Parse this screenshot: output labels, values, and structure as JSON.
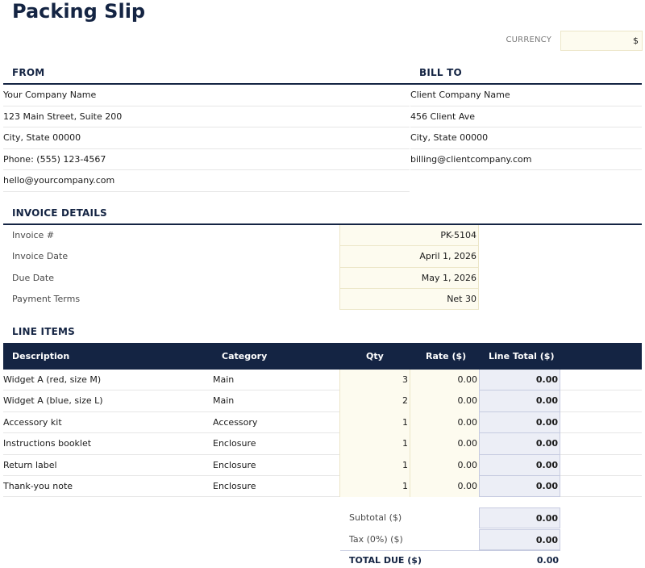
{
  "title": "Packing Slip",
  "currency": {
    "label": "CURRENCY",
    "value": "$"
  },
  "from": {
    "heading": "FROM",
    "lines": [
      "Your Company Name",
      "123 Main Street, Suite 200",
      "City, State 00000",
      "Phone: (555) 123-4567",
      "hello@yourcompany.com"
    ]
  },
  "bill_to": {
    "heading": "BILL TO",
    "lines": [
      "Client Company Name",
      "456 Client Ave",
      "City, State 00000",
      "billing@clientcompany.com"
    ]
  },
  "invoice_details": {
    "heading": "INVOICE DETAILS",
    "rows": [
      {
        "label": "Invoice #",
        "value": "PK-5104"
      },
      {
        "label": "Invoice Date",
        "value": "April 1, 2026"
      },
      {
        "label": "Due Date",
        "value": "May 1, 2026"
      },
      {
        "label": "Payment Terms",
        "value": "Net 30"
      }
    ]
  },
  "line_items": {
    "heading": "LINE ITEMS",
    "columns": {
      "description": "Description",
      "category": "Category",
      "qty": "Qty",
      "rate": "Rate ($)",
      "line_total": "Line Total ($)"
    },
    "rows": [
      {
        "description": "Widget A (red, size M)",
        "category": "Main",
        "qty": "3",
        "rate": "0.00",
        "line_total": "0.00"
      },
      {
        "description": "Widget A (blue, size L)",
        "category": "Main",
        "qty": "2",
        "rate": "0.00",
        "line_total": "0.00"
      },
      {
        "description": "Accessory kit",
        "category": "Accessory",
        "qty": "1",
        "rate": "0.00",
        "line_total": "0.00"
      },
      {
        "description": "Instructions booklet",
        "category": "Enclosure",
        "qty": "1",
        "rate": "0.00",
        "line_total": "0.00"
      },
      {
        "description": "Return label",
        "category": "Enclosure",
        "qty": "1",
        "rate": "0.00",
        "line_total": "0.00"
      },
      {
        "description": "Thank-you note",
        "category": "Enclosure",
        "qty": "1",
        "rate": "0.00",
        "line_total": "0.00"
      }
    ]
  },
  "totals": {
    "subtotal_label": "Subtotal ($)",
    "subtotal_value": "0.00",
    "tax_label": "Tax (0%) ($)",
    "tax_value": "0.00",
    "total_label": "TOTAL DUE ($)",
    "total_value": "0.00"
  },
  "colors": {
    "navy": "#142443",
    "input_fill": "#fdfbef",
    "calc_fill": "#eceef6"
  }
}
